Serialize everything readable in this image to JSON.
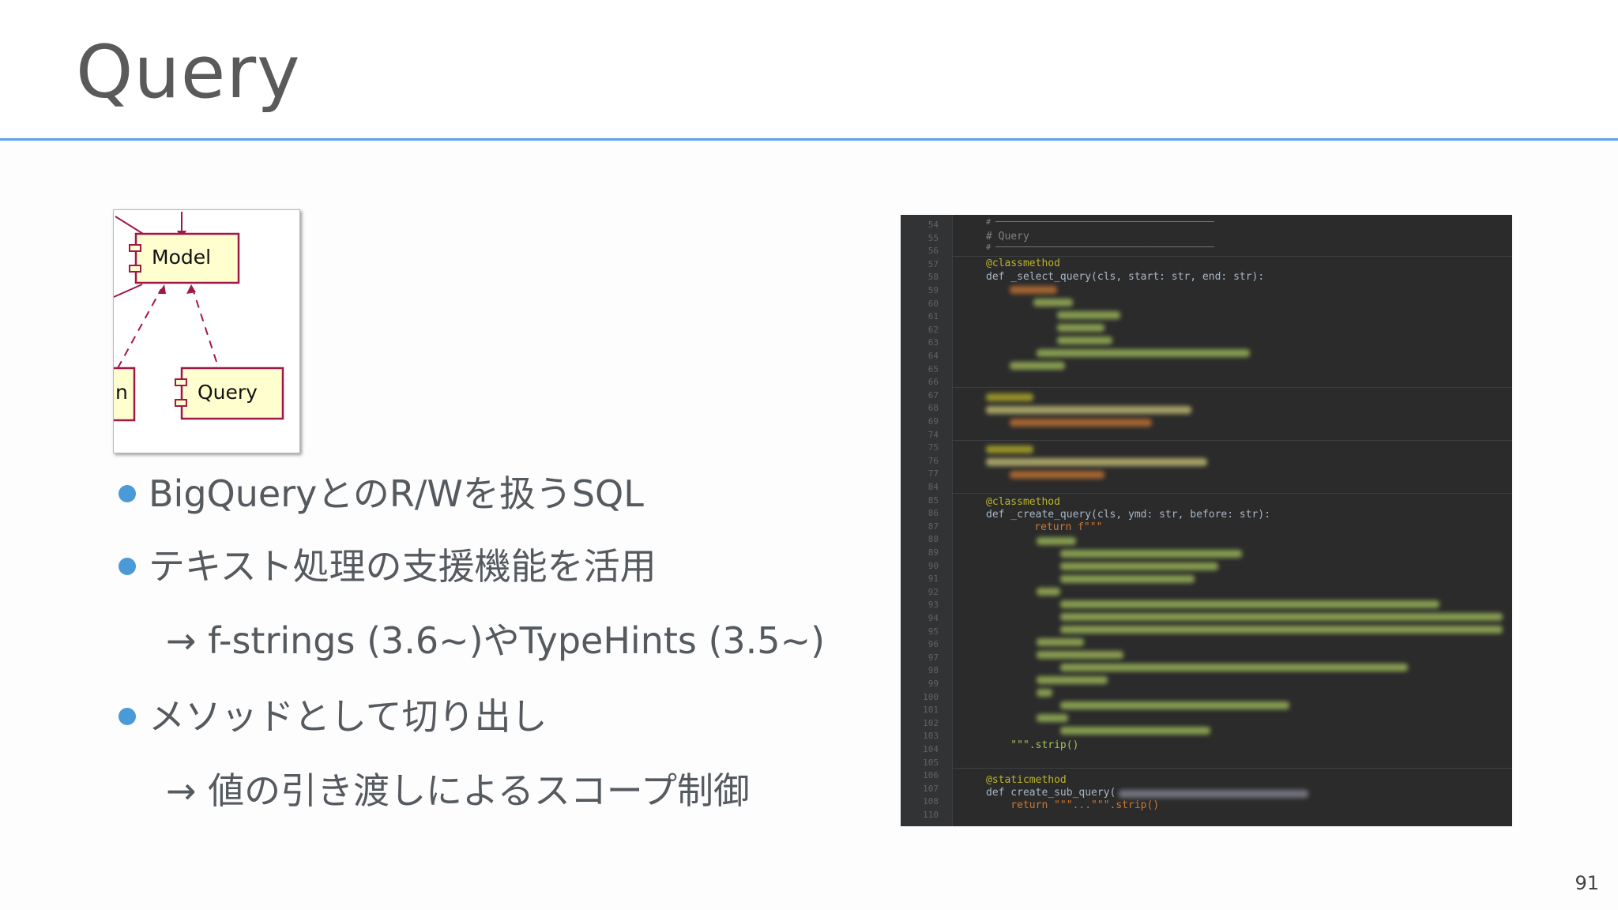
{
  "slide": {
    "title": "Query",
    "page_number": "91",
    "accent_color": "#5aa4e6",
    "bullet_color": "#4a9ad8"
  },
  "uml": {
    "model_label": "Model",
    "query_label": "Query",
    "partial_label": "n"
  },
  "bullets": [
    {
      "text": "BigQueryとのR/Wを扱うSQL",
      "level": 1
    },
    {
      "text": "テキスト処理の支援機能を活用",
      "level": 1
    },
    {
      "text": "→ f-strings (3.6~)やTypeHints (3.5~)",
      "level": 2
    },
    {
      "text": "メソッドとして切り出し",
      "level": 1
    },
    {
      "text": "→ 値の引き渡しによるスコープ制御",
      "level": 2
    }
  ],
  "code": {
    "line_numbers": [
      "54",
      "55",
      "56",
      "57",
      "58",
      "59",
      "60",
      "61",
      "62",
      "63",
      "64",
      "65",
      "66",
      "67",
      "68",
      "69",
      "74",
      "75",
      "76",
      "77",
      "84",
      "85",
      "86",
      "87",
      "88",
      "89",
      "90",
      "91",
      "92",
      "93",
      "94",
      "95",
      "96",
      "97",
      "98",
      "99",
      "100",
      "101",
      "102",
      "103",
      "104",
      "105",
      "106",
      "107",
      "108",
      "110"
    ],
    "lines": [
      "# ──────────────────────────────────────────────",
      "# Query",
      "# ──────────────────────────────────────────────",
      "@classmethod",
      "def _select_query(cls, start: str, end: str):",
      "@classmethod",
      "def _create_query(cls, ymd: str, before: str):",
      "    return f\"\"\"",
      "    \"\"\".strip()",
      "@staticmethod",
      "def create_sub_query(",
      "    return \"\"\"...\"\"\".strip()"
    ]
  }
}
